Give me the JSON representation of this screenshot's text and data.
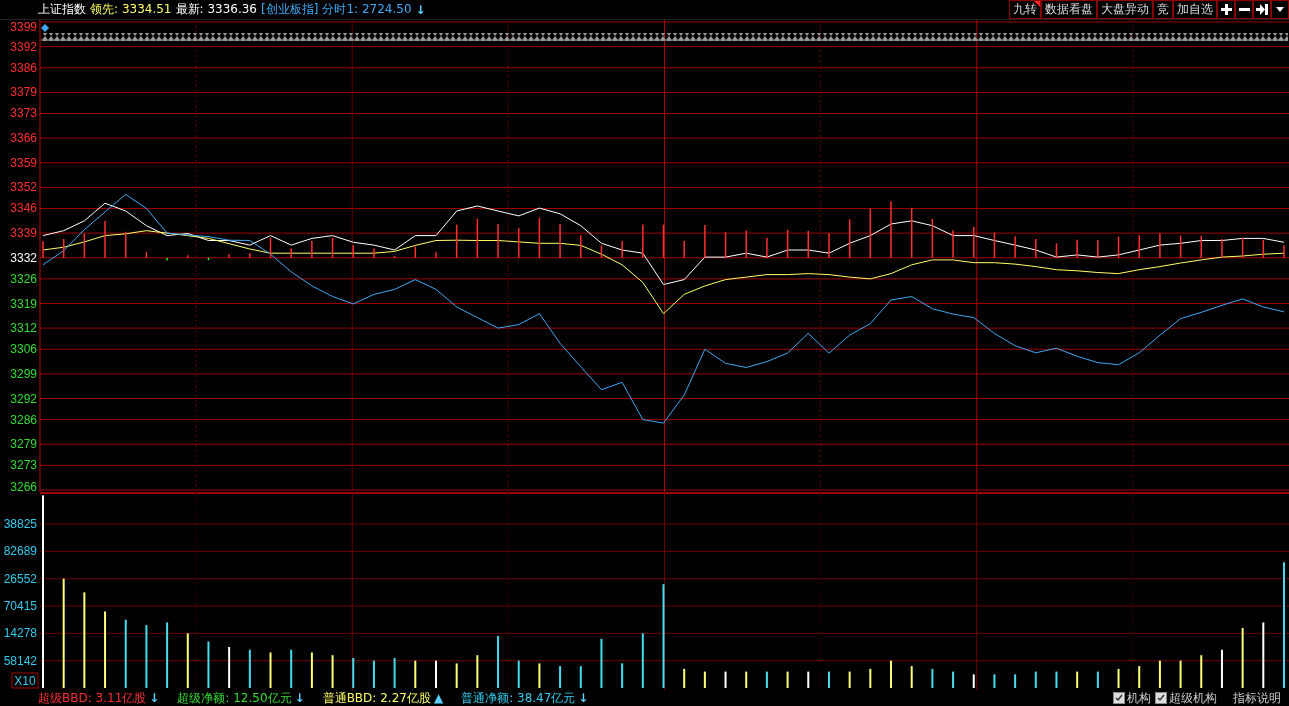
{
  "header": {
    "title": "上证指数",
    "lead": {
      "label": "领先:",
      "value": "3334.51"
    },
    "latest": {
      "label": "最新:",
      "value": "3336.36"
    },
    "overlay": "[创业板指]",
    "timeshare": {
      "label": "分时1:",
      "value": "2724.50",
      "arrow": "↓"
    }
  },
  "toolbar": {
    "buttons": [
      {
        "label": "九转",
        "flagged": true
      },
      {
        "label": "数据看盘",
        "flagged": false
      },
      {
        "label": "大盘异动",
        "flagged": false
      },
      {
        "label": "竞",
        "flagged": false
      },
      {
        "label": "加自选",
        "flagged": false
      }
    ]
  },
  "price_chart": {
    "chart_data": {
      "type": "line",
      "ylim": [
        3266,
        3399
      ],
      "grid": true,
      "yticks": [
        3399,
        3392,
        3386,
        3379,
        3373,
        3366,
        3359,
        3352,
        3346,
        3339,
        3332,
        3326,
        3319,
        3312,
        3306,
        3299,
        3292,
        3286,
        3279,
        3273,
        3266
      ],
      "series": [
        {
          "color": "#ffffff",
          "values": [
            3338.3,
            3339.7,
            3342.5,
            3347.5,
            3345.3,
            3341.1,
            3338.3,
            3338.9,
            3336.9,
            3336.9,
            3335.6,
            3338.3,
            3335.6,
            3337.5,
            3338.3,
            3336.4,
            3335.6,
            3334.2,
            3338.3,
            3338.3,
            3345.3,
            3346.7,
            3345.3,
            3343.9,
            3346.1,
            3344.5,
            3341.1,
            3336.1,
            3334.2,
            3333.3,
            3324.4,
            3325.8,
            3332.2,
            3332.2,
            3333.3,
            3332.2,
            3334.2,
            3334.2,
            3333.3,
            3336.1,
            3338.3,
            3341.6,
            3342.5,
            3341.1,
            3338.3,
            3338.3,
            3336.9,
            3335.6,
            3334.2,
            3332.2,
            3332.8,
            3332.2,
            3332.8,
            3334.2,
            3335.6,
            3336.1,
            3336.9,
            3336.9,
            3337.5,
            3337.5,
            3336.4
          ]
        },
        {
          "color": "#ffff66",
          "values": [
            3334.2,
            3335,
            3336.5,
            3338.3,
            3338.8,
            3339.7,
            3339,
            3338.3,
            3337.5,
            3336,
            3334.5,
            3333.3,
            3333.3,
            3333.3,
            3333.3,
            3333.3,
            3333.3,
            3333.8,
            3335.5,
            3336.9,
            3337,
            3336.9,
            3336.9,
            3336.5,
            3336.1,
            3336.1,
            3335.5,
            3333,
            3330,
            3325,
            3316.1,
            3321.6,
            3324,
            3325.8,
            3326.5,
            3327.2,
            3327.2,
            3327.5,
            3327.2,
            3326.5,
            3326,
            3327.5,
            3330,
            3331.4,
            3331.4,
            3330.6,
            3330.6,
            3330.2,
            3329.5,
            3328.6,
            3328.3,
            3327.8,
            3327.5,
            3328.6,
            3329.5,
            3330.5,
            3331.4,
            3332.2,
            3332.5,
            3333,
            3333.3
          ]
        },
        {
          "color": "#3fa9f5",
          "values": [
            3330,
            3334,
            3340,
            3345,
            3350,
            3346,
            3339,
            3338.5,
            3338,
            3337,
            3336.9,
            3333,
            3328,
            3324,
            3321,
            3318.9,
            3321.6,
            3323,
            3325.8,
            3323,
            3318,
            3315,
            3312,
            3313,
            3316.1,
            3307.7,
            3301,
            3294.5,
            3296.6,
            3286,
            3285,
            3293,
            3306,
            3302,
            3300.8,
            3302.5,
            3304.9,
            3310.5,
            3304.9,
            3310,
            3313.3,
            3320,
            3321,
            3317.5,
            3316,
            3315,
            3310.5,
            3307,
            3305,
            3306.3,
            3304,
            3302.2,
            3301.6,
            3305,
            3310,
            3314.7,
            3316.5,
            3318.5,
            3320.3,
            3318,
            3316.6
          ]
        }
      ]
    }
  },
  "volume_chart": {
    "scale": "X10",
    "axis_labels": [
      "38825",
      "82689",
      "26552",
      "70415",
      "14278",
      "58142"
    ]
  },
  "status_bar": {
    "stats": [
      {
        "text": "超级BBD: 3.11亿股",
        "color": "#ff3030",
        "arrow": "↓"
      },
      {
        "text": "超级净额: 12.50亿元",
        "color": "#33dd33",
        "arrow": "↓"
      },
      {
        "text": "普通BBD: 2.27亿股",
        "color": "#ffff66",
        "arrow": "▲"
      },
      {
        "text": "普通净额: 38.47亿元",
        "color": "#33ccee",
        "arrow": "↓"
      }
    ],
    "checks": [
      {
        "label": "机构",
        "checked": true
      },
      {
        "label": "超级机构",
        "checked": true
      }
    ],
    "link": "指标说明"
  }
}
